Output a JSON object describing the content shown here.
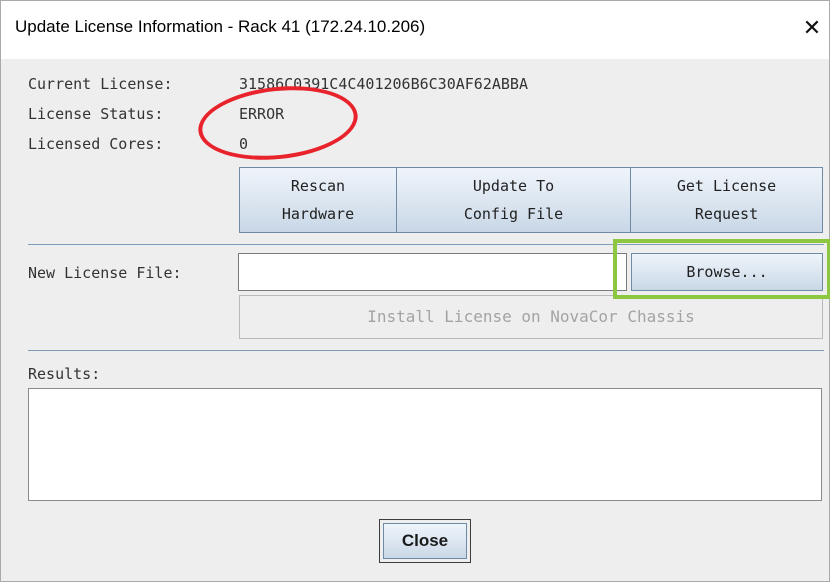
{
  "window": {
    "title": "Update License Information - Rack 41 (172.24.10.206)",
    "close_glyph": "✕"
  },
  "license_info": {
    "current_license_label": "Current License:",
    "current_license_value": "31586C0391C4C401206B6C30AF62ABBA",
    "status_label": "License Status:",
    "status_value": "ERROR",
    "cores_label": "Licensed Cores:",
    "cores_value": "0"
  },
  "actions": {
    "rescan_line1": "Rescan",
    "rescan_line2": "Hardware",
    "update_line1": "Update To",
    "update_line2": "Config File",
    "request_line1": "Get License",
    "request_line2": "Request"
  },
  "new_license": {
    "label": "New License File:",
    "value": "",
    "browse_label": "Browse...",
    "install_label": "Install License on NovaCor Chassis"
  },
  "results": {
    "label": "Results:",
    "value": ""
  },
  "footer": {
    "close_label": "Close"
  },
  "colors": {
    "red_annotation": "#e8232b",
    "green_annotation": "#8dc63f",
    "button_border": "#6e8aa6",
    "disabled_text": "#a3a3a3"
  }
}
